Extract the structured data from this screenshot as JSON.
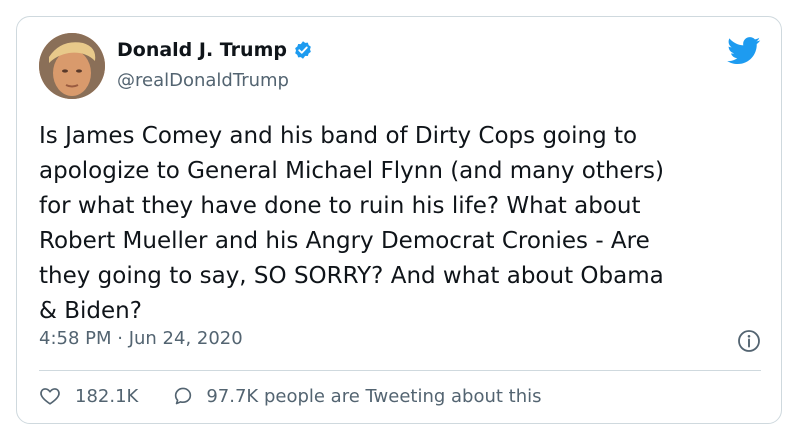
{
  "author": {
    "name": "Donald J. Trump",
    "handle": "@realDonaldTrump"
  },
  "tweet": {
    "text": "Is James Comey and his band of Dirty Cops going to\napologize to General Michael Flynn (and many others)\nfor what they have done to ruin his life? What about\nRobert Mueller and his Angry Democrat Cronies - Are\nthey going to say, SO SORRY? And what about Obama\n& Biden?",
    "timestamp": "4:58 PM · Jun 24, 2020"
  },
  "stats": {
    "likes": "182.1K",
    "talking": "97.7K people are Tweeting about this"
  },
  "icons": {
    "verified": "verified-badge-icon",
    "brand": "twitter-bird-icon",
    "info": "info-icon",
    "like": "heart-icon",
    "reply": "speech-bubble-icon"
  },
  "colors": {
    "brand_blue": "#1d9bf0",
    "text": "#0f1419",
    "muted": "#536471",
    "border": "#cfd9de"
  }
}
